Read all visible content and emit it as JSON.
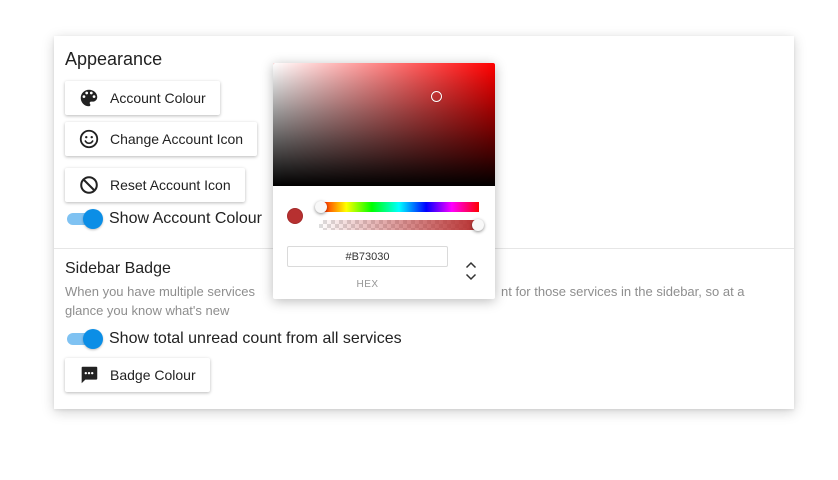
{
  "appearance": {
    "title": "Appearance",
    "account_colour_label": "Account Colour",
    "change_icon_label": "Change Account Icon",
    "reset_icon_label": "Reset Account Icon",
    "show_colour_label": "Show Account Colour",
    "show_colour_on": true
  },
  "sidebar_badge": {
    "title": "Sidebar Badge",
    "description_line1_left": "When you have multiple services",
    "description_line1_right": "nt for those services in the sidebar, so at a",
    "description_line2": "glance you know what's new",
    "show_total_label": "Show total unread count from all services",
    "show_total_on": true,
    "badge_colour_label": "Badge Colour"
  },
  "picker": {
    "hex_value": "#B73030",
    "mode_label": "HEX",
    "current_color": "#B73030",
    "hue_color": "#FF0000",
    "hue_position": 0.0,
    "alpha_position": 1.0
  },
  "colors": {
    "toggle_on": "#0B8EE6",
    "toggle_track": "#7FC2F2"
  }
}
